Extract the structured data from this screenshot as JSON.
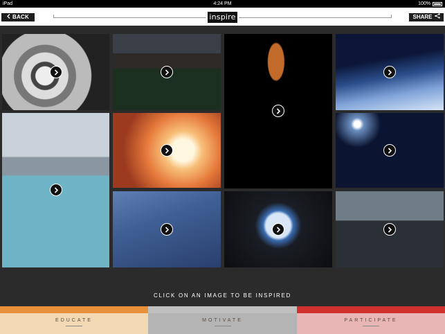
{
  "status_bar": {
    "device": "iPad",
    "time": "4:24 PM",
    "battery": "100%"
  },
  "header": {
    "back_label": "BACK",
    "logo_text": "inspire",
    "share_label": "SHARE"
  },
  "grid": {
    "tiles": [
      {
        "name": "astronaut"
      },
      {
        "name": "students"
      },
      {
        "name": "planet-fire"
      },
      {
        "name": "earth-orbit"
      },
      {
        "name": "capsule"
      },
      {
        "name": "launch"
      },
      {
        "name": "night-lights"
      },
      {
        "name": "spacecraft"
      },
      {
        "name": "cupola"
      },
      {
        "name": "kennedy"
      }
    ]
  },
  "cta": {
    "text": "CLICK ON AN IMAGE TO BE INSPIRED"
  },
  "tabs": [
    {
      "label": "EDUCATE",
      "bar_color": "#e8913a",
      "bg_color": "#f2d9b4"
    },
    {
      "label": "MOTIVATE",
      "bar_color": "#bfbfbf",
      "bg_color": "#b4b4b4"
    },
    {
      "label": "PARTICIPATE",
      "bar_color": "#d0312d",
      "bg_color": "#e8b6b4"
    }
  ]
}
